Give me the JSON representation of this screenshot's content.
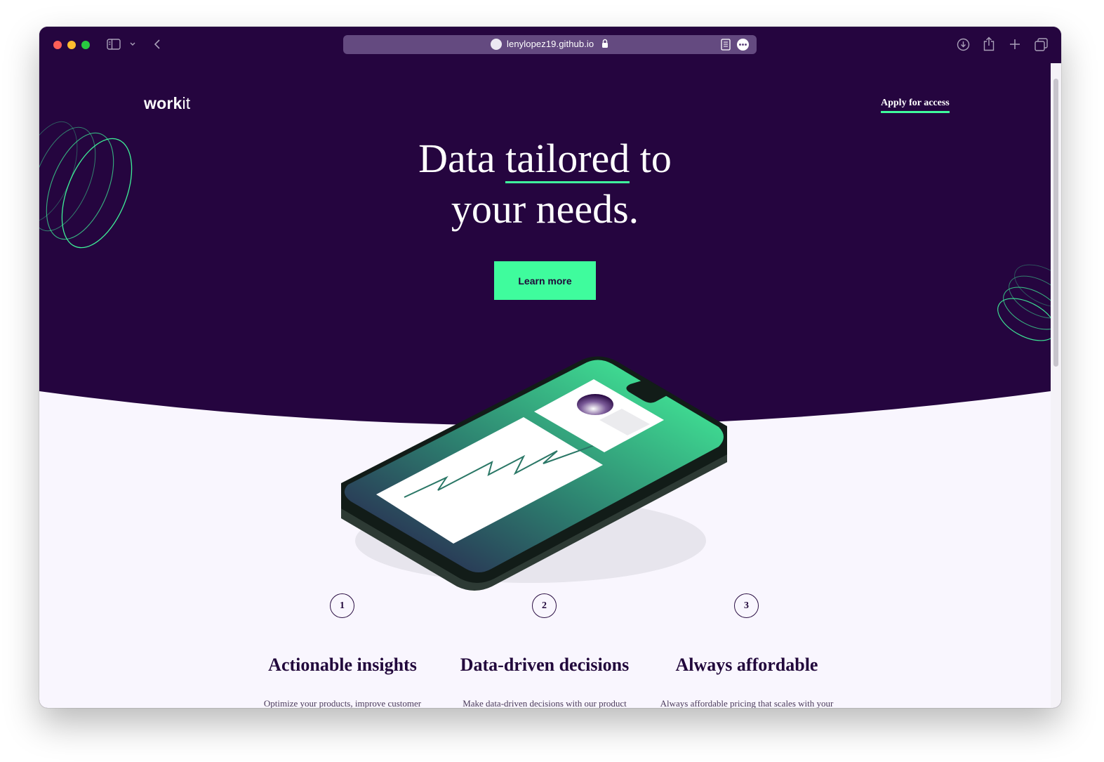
{
  "browser": {
    "url": "lenylopez19.github.io"
  },
  "nav": {
    "logo_bold": "work",
    "logo_light": "it",
    "apply_label": "Apply for access"
  },
  "hero": {
    "line1_pre": "Data ",
    "line1_highlight": "tailored",
    "line1_post": " to",
    "line2": "your needs.",
    "cta_label": "Learn more"
  },
  "features": [
    {
      "number": "1",
      "title": "Actionable insights",
      "desc": "Optimize your products, improve customer"
    },
    {
      "number": "2",
      "title": "Data-driven decisions",
      "desc": "Make data-driven decisions with our product"
    },
    {
      "number": "3",
      "title": "Always affordable",
      "desc": "Always affordable pricing that scales with your"
    }
  ],
  "colors": {
    "hero_bg": "#25053f",
    "accent": "#3ffc9d",
    "page_bg": "#f9f6fe",
    "heading": "#22083c"
  },
  "icons": [
    "sidebar-icon",
    "chevron-down-icon",
    "back-icon",
    "globe-icon",
    "lock-icon",
    "reader-icon",
    "more-icon",
    "download-icon",
    "share-icon",
    "plus-icon",
    "tabs-icon"
  ]
}
